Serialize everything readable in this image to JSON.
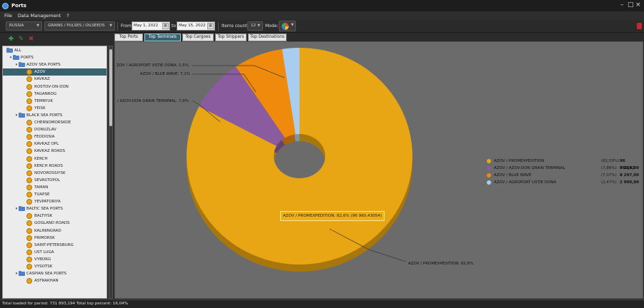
{
  "window": {
    "title": "Ports"
  },
  "menu": [
    "File",
    "Data Management",
    "?"
  ],
  "toolbar": {
    "country": "RUSSIA",
    "commodity": "GRAINS / PULSES / OILSEEDS",
    "from_label": "From",
    "from_date": "May 1, 2022",
    "to_label": "to",
    "to_date": "May 15, 2022",
    "items_count_label": "Items count:",
    "items_count": "12",
    "mode_label": "Mode:"
  },
  "tree": [
    {
      "label": "ALL",
      "level": 0,
      "type": "folder",
      "expanded": true
    },
    {
      "label": "PORTS",
      "level": 1,
      "type": "folder",
      "expanded": true
    },
    {
      "label": "AZOV SEA PORTS",
      "level": 2,
      "type": "folder",
      "expanded": true
    },
    {
      "label": "AZOV",
      "level": 3,
      "type": "port",
      "selected": true
    },
    {
      "label": "KAVKAZ",
      "level": 3,
      "type": "port"
    },
    {
      "label": "ROSTOV-ON-DON",
      "level": 3,
      "type": "port"
    },
    {
      "label": "TAGANROG",
      "level": 3,
      "type": "port"
    },
    {
      "label": "TEMRYUK",
      "level": 3,
      "type": "port"
    },
    {
      "label": "YEISK",
      "level": 3,
      "type": "port"
    },
    {
      "label": "BLACK SEA PORTS",
      "level": 2,
      "type": "folder",
      "expanded": true
    },
    {
      "label": "CHERNOMORSKOE",
      "level": 3,
      "type": "port"
    },
    {
      "label": "DONUZLAV",
      "level": 3,
      "type": "port"
    },
    {
      "label": "FEODOSIA",
      "level": 3,
      "type": "port"
    },
    {
      "label": "KAVKAZ OPL",
      "level": 3,
      "type": "port"
    },
    {
      "label": "KAVKAZ ROADS",
      "level": 3,
      "type": "port"
    },
    {
      "label": "KERCH",
      "level": 3,
      "type": "port"
    },
    {
      "label": "KERCH ROADS",
      "level": 3,
      "type": "port"
    },
    {
      "label": "NOVOROSSIYSK",
      "level": 3,
      "type": "port"
    },
    {
      "label": "SEVASTOPOL",
      "level": 3,
      "type": "port"
    },
    {
      "label": "TAMAN",
      "level": 3,
      "type": "port"
    },
    {
      "label": "TUAPSE",
      "level": 3,
      "type": "port"
    },
    {
      "label": "YEVPATORIYA",
      "level": 3,
      "type": "port"
    },
    {
      "label": "BALTIC SEA PORTS",
      "level": 2,
      "type": "folder",
      "expanded": true
    },
    {
      "label": "BALTIYSK",
      "level": 3,
      "type": "port"
    },
    {
      "label": "GOGLAND ROADS",
      "level": 3,
      "type": "port"
    },
    {
      "label": "KALININGRAD",
      "level": 3,
      "type": "port"
    },
    {
      "label": "PRIMORSK",
      "level": 3,
      "type": "port"
    },
    {
      "label": "SAINT-PETERSBURG",
      "level": 3,
      "type": "port"
    },
    {
      "label": "UST LUGA",
      "level": 3,
      "type": "port"
    },
    {
      "label": "VYBORG",
      "level": 3,
      "type": "port"
    },
    {
      "label": "VYSOTSK",
      "level": 3,
      "type": "port"
    },
    {
      "label": "CASPIAN SEA PORTS",
      "level": 2,
      "type": "folder",
      "expanded": true
    },
    {
      "label": "ASTRAKHAN",
      "level": 3,
      "type": "port"
    }
  ],
  "tabs": [
    {
      "label": "Top Ports",
      "active": false
    },
    {
      "label": "Top Terminals",
      "active": true
    },
    {
      "label": "Top Cargoes",
      "active": false
    },
    {
      "label": "Top Shippers",
      "active": false
    },
    {
      "label": "Top Destinations",
      "active": false
    }
  ],
  "chart_data": {
    "type": "pie",
    "slices": [
      {
        "name": "AZOV / PROMEXPEDITION",
        "value": 96960.43,
        "value_text": "96 960,43",
        "percent_text": "(82,59%)",
        "callout": "AZOV / PROMEXPEDITION: 82,6%",
        "color": "#e8a514"
      },
      {
        "name": "AZOV / AZOV-DON GRAIN TERMINAL",
        "value": 9255.0,
        "value_text": "9 255,00",
        "percent_text": "(7,88%)",
        "callout": "/ AZOV-DON GRAIN TERMINAL: 7,9%",
        "color": "#8b5b9f"
      },
      {
        "name": "AZOV / BLUE WAVE",
        "value": 8297.0,
        "value_text": "8 297,00",
        "percent_text": "(7,07%)",
        "callout": "AZOV / BLUE WAVE: 7,1%",
        "color": "#f08a0c"
      },
      {
        "name": "AZOV / AGROPORT USTIE DONA",
        "value": 2900.0,
        "value_text": "2 900,00",
        "percent_text": "(2,47%)",
        "callout": "ZOV / AGROPORT USTIE DONA: 2,5%",
        "color": "#a8cdf0"
      }
    ],
    "tooltip": "AZOV / PROMEXPEDITION: 82,6% (96 960,43054)",
    "legend_position": "right"
  },
  "status": {
    "text": "Total loaded for period: 731 893,194 Total top percent: 16,04%"
  }
}
